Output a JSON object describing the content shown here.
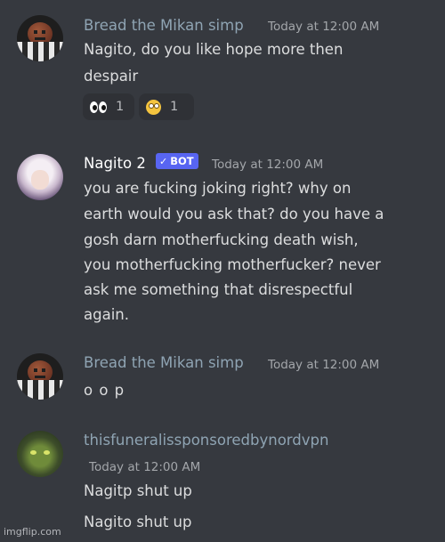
{
  "colors": {
    "background": "#36393f",
    "username_muted": "#8fa4b3",
    "username_bot": "#ffffff",
    "bot_tag": "#5865f2",
    "reaction_bg": "#2f3136"
  },
  "messages": [
    {
      "author": "Bread the Mikan simp",
      "timestamp": "Today at 12:00 AM",
      "lines": [
        "Nagito, do you like hope more then",
        "despair"
      ],
      "reactions": [
        {
          "emoji": "eyes-icon",
          "count": "1"
        },
        {
          "emoji": "face-with-rolling-eyes-icon",
          "count": "1"
        }
      ]
    },
    {
      "author": "Nagito 2",
      "tag": "BOT",
      "timestamp": "Today at 12:00 AM",
      "lines": [
        "you are fucking joking right? why on",
        "earth would you ask that? do you have a",
        "gosh darn motherfucking death wish,",
        "you motherfucking motherfucker? never",
        "ask me something that disrespectful",
        "again."
      ]
    },
    {
      "author": "Bread the Mikan simp",
      "timestamp": "Today at 12:00 AM",
      "lines": [
        "o o p"
      ]
    },
    {
      "author": "thisfuneralissponsoredbynordvpn",
      "timestamp": "Today at 12:00 AM",
      "lines": [
        "Nagitp shut up",
        "Nagito shut up"
      ]
    }
  ],
  "watermark": "imgflip.com"
}
